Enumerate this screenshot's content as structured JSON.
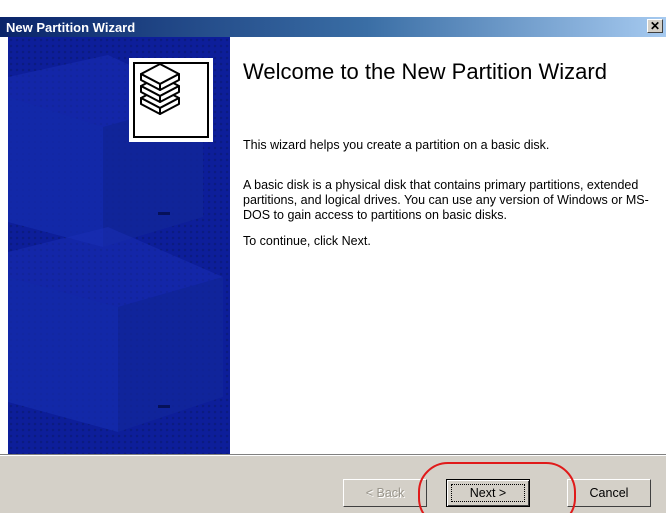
{
  "window": {
    "title": "New Partition Wizard",
    "close_symbol": "✕"
  },
  "side_panel": {
    "background_color": "#0d1e9a",
    "logo_icon": "disk-stack-icon"
  },
  "main": {
    "heading": "Welcome to the New Partition Wizard",
    "paragraph_1": "This wizard helps you create a partition on a basic disk.",
    "paragraph_2": "A basic disk is a physical disk that contains primary partitions, extended partitions, and logical drives. You can use any version of Windows or MS-DOS to gain access to partitions on basic disks.",
    "paragraph_3": "To continue, click Next."
  },
  "footer": {
    "back_label": "< Back",
    "next_label": "Next >",
    "cancel_label": "Cancel"
  },
  "annotation": {
    "highlight_color": "#e01a1a"
  }
}
